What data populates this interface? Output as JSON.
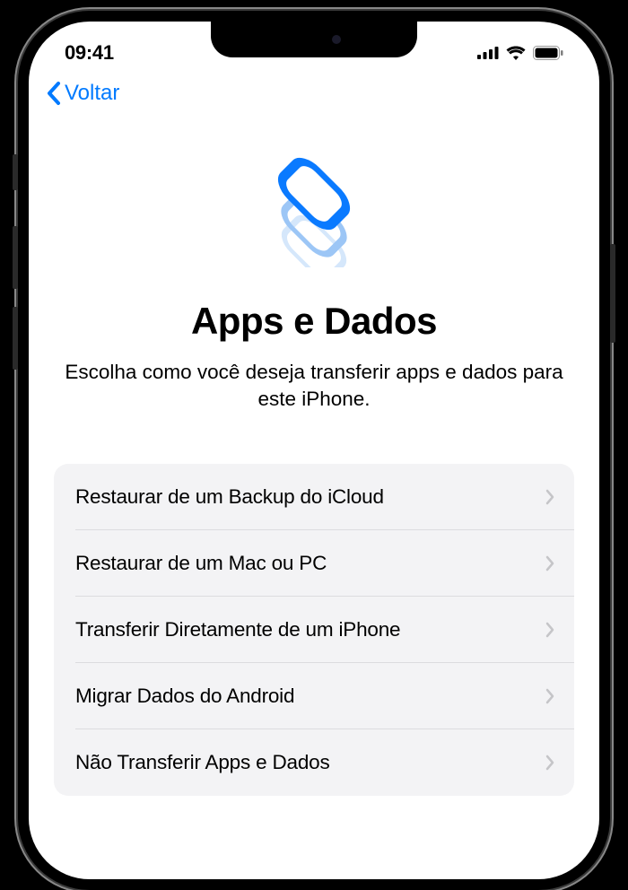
{
  "status": {
    "time": "09:41"
  },
  "nav": {
    "back_label": "Voltar"
  },
  "page": {
    "title": "Apps e Dados",
    "subtitle": "Escolha como você deseja transferir apps e dados para este iPhone."
  },
  "options": [
    {
      "label": "Restaurar de um Backup do iCloud"
    },
    {
      "label": "Restaurar de um Mac ou PC"
    },
    {
      "label": "Transferir Diretamente de um iPhone"
    },
    {
      "label": "Migrar Dados do Android"
    },
    {
      "label": "Não Transferir Apps e Dados"
    }
  ],
  "colors": {
    "accent": "#007AFF"
  }
}
